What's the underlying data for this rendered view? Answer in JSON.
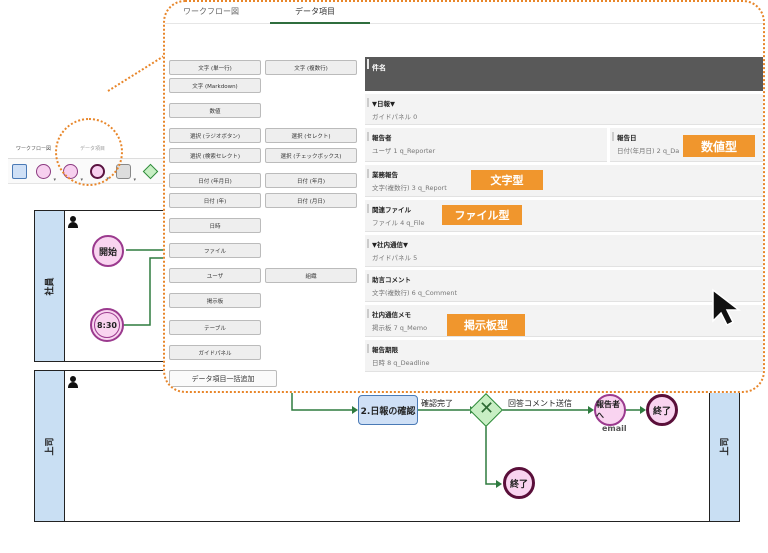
{
  "diagram": {
    "mini_tabs": [
      "ワークフロー図",
      "データ項目"
    ],
    "toolbar_icons": [
      "task-shape-icon",
      "start-event-icon",
      "intermediate-event-icon",
      "end-event-icon",
      "box-icon",
      "gateway-icon"
    ],
    "lanes": [
      {
        "label": "社員"
      },
      {
        "label": "上司",
        "right_label": "上司"
      }
    ],
    "nodes": {
      "start": "開始",
      "timer": "8:30",
      "task_confirm": "2.日報の確認",
      "end1": "終了",
      "end2": "終了",
      "notify_task": "報告者へ",
      "notify_sub": "email"
    },
    "edges": {
      "confirm_done": "確認完了",
      "comment_send": "回答コメント送信"
    }
  },
  "panel": {
    "tabs": [
      "ワークフロー図",
      "データ項目"
    ],
    "active_tab": 1,
    "palette": [
      {
        "label": "文字 (単一行)"
      },
      {
        "label": "文字 (複数行)"
      },
      {
        "label": "文字 (Markdown)"
      },
      {
        "label": "数値"
      },
      {
        "label": "選択 (ラジオボタン)"
      },
      {
        "label": "選択 (セレクト)"
      },
      {
        "label": "選択 (検索セレクト)"
      },
      {
        "label": "選択 (チェックボックス)"
      },
      {
        "label": "日付 (年月日)"
      },
      {
        "label": "日付 (年月)"
      },
      {
        "label": "日付 (年)"
      },
      {
        "label": "日付 (月日)"
      },
      {
        "label": "日時"
      },
      {
        "label": "ファイル"
      },
      {
        "label": "ユーザ"
      },
      {
        "label": "組織"
      },
      {
        "label": "掲示板"
      },
      {
        "label": "テーブル"
      },
      {
        "label": "ガイドパネル"
      }
    ],
    "bulk_add": "データ項目一括追加",
    "form_title": "件名",
    "fields": [
      {
        "label": "▼日報▼",
        "sub": "ガイドパネル 0"
      },
      {
        "label": "報告者",
        "sub": "ユーザ 1 q_Reporter"
      },
      {
        "label": "報告日",
        "sub": "日付(年月日) 2 q_Da"
      },
      {
        "label": "業務報告",
        "sub": "文字(複数行) 3 q_Report"
      },
      {
        "label": "関連ファイル",
        "sub": "ファイル 4 q_File"
      },
      {
        "label": "▼社内通信▼",
        "sub": "ガイドパネル 5"
      },
      {
        "label": "助言コメント",
        "sub": "文字(複数行) 6 q_Comment"
      },
      {
        "label": "社内通信メモ",
        "sub": "掲示板 7 q_Memo"
      },
      {
        "label": "報告期限",
        "sub": "日時 8 q_Deadline"
      }
    ],
    "tags": {
      "number": "数値型",
      "text": "文字型",
      "file": "ファイル型",
      "board": "掲示板型"
    },
    "colors": {
      "accent_orange": "#f0962d",
      "tab_underline": "#2f6e3e",
      "form_header": "#595959"
    }
  }
}
